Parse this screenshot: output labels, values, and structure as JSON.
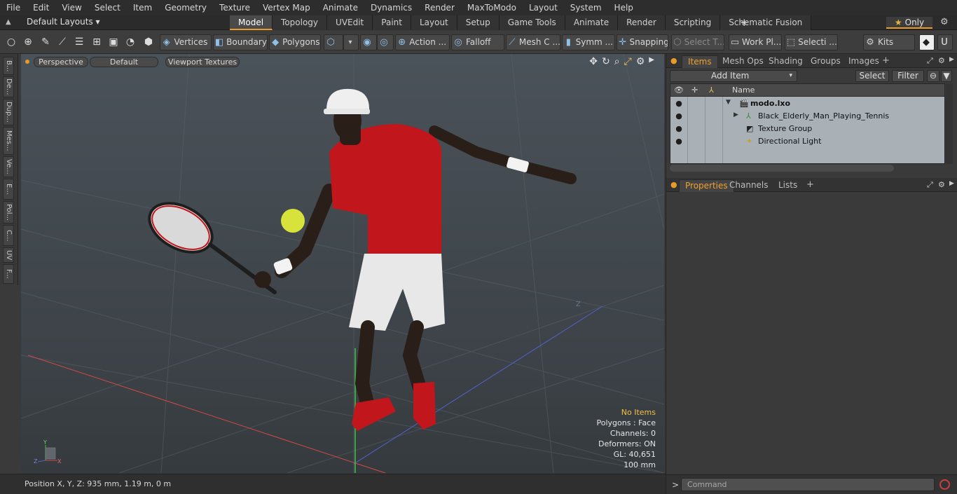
{
  "menu": [
    "File",
    "Edit",
    "View",
    "Select",
    "Item",
    "Geometry",
    "Texture",
    "Vertex Map",
    "Animate",
    "Dynamics",
    "Render",
    "MaxToModo",
    "Layout",
    "System",
    "Help"
  ],
  "layout": {
    "dropdown": "Default Layouts ▾",
    "tabs": [
      "Model",
      "Topology",
      "UVEdit",
      "Paint",
      "Layout",
      "Setup",
      "Game Tools",
      "Animate",
      "Render",
      "Scripting",
      "Schematic Fusion"
    ],
    "active_tab": "Model",
    "only_label": "Only"
  },
  "toolbar": {
    "vertices": "Vertices",
    "boundary": "Boundary",
    "polygons": "Polygons",
    "action": "Action ...",
    "falloff": "Falloff",
    "mesh": "Mesh C ...",
    "symm": "Symm ...",
    "snapping": "Snapping",
    "select_t": "Select T...",
    "work_pl": "Work Pl...",
    "selecti": "Selecti ...",
    "kits": "Kits"
  },
  "left_tabs": [
    "B...",
    "De...",
    "Dup...",
    "Mes...",
    "Ve...",
    "E...",
    "Pol...",
    "C...",
    "UV",
    "F..."
  ],
  "viewport": {
    "view_mode": "Perspective",
    "shading": "Default",
    "textures": "Viewport Textures",
    "stats": {
      "selection": "No Items",
      "polygons": "Polygons : Face",
      "channels": "Channels: 0",
      "deformers": "Deformers: ON",
      "gl": "GL: 40,651",
      "grid": "100 mm"
    }
  },
  "status": {
    "position": "Position X, Y, Z:   935 mm, 1.19 m, 0 m"
  },
  "items_panel": {
    "tabs": [
      "Items",
      "Mesh Ops",
      "Shading",
      "Groups",
      "Images"
    ],
    "active_tab": "Items",
    "add_item": "Add Item",
    "select": "Select",
    "filter": "Filter",
    "column_name": "Name",
    "rows": [
      {
        "label": "modo.lxo"
      },
      {
        "label": "Black_Elderly_Man_Playing_Tennis"
      },
      {
        "label": "Texture Group"
      },
      {
        "label": "Directional Light"
      }
    ]
  },
  "properties_panel": {
    "tabs": [
      "Properties",
      "Channels",
      "Lists"
    ],
    "active_tab": "Properties"
  },
  "command": {
    "placeholder": "Command",
    "prompt": ">"
  },
  "colors": {
    "accent": "#e89a2b",
    "shirt": "#c0161c",
    "ball": "#d7e33a",
    "tree_bg": "#a9b0b6"
  }
}
